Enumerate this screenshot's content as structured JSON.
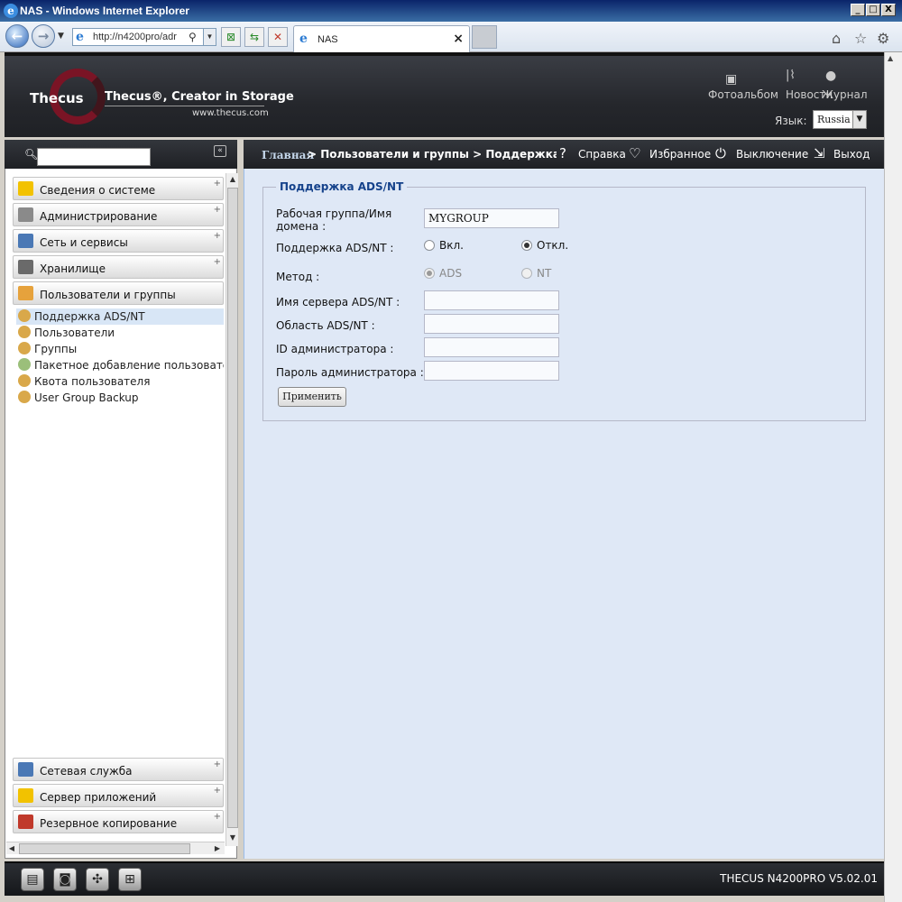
{
  "window": {
    "title": "NAS - Windows Internet Explorer",
    "minimize": "_",
    "maximize": "□",
    "close": "X"
  },
  "browser": {
    "address": "http://n4200pro/adr",
    "tab_title": "NAS",
    "tab_close": "×"
  },
  "header": {
    "brand": "Thecus",
    "tagline": "Thecus®, Creator in Storage",
    "website": "www.thecus.com",
    "links": [
      "Фотоальбом",
      "Новости",
      "Журнал"
    ],
    "language_label": "Язык:",
    "language_value": "Russia"
  },
  "sidebar": {
    "collapse_label": "«",
    "categories_top": [
      {
        "label": "Сведения о системе",
        "icon": "info-icon",
        "color": "#f2c200"
      },
      {
        "label": "Администрирование",
        "icon": "tools-icon",
        "color": "#8a8a8a"
      },
      {
        "label": "Сеть и сервисы",
        "icon": "network-icon",
        "color": "#4a78b5"
      },
      {
        "label": "Хранилище",
        "icon": "storage-icon",
        "color": "#6a6a6a"
      },
      {
        "label": "Пользователи и группы",
        "icon": "users-icon",
        "color": "#e6a23c"
      }
    ],
    "sub_items": [
      {
        "label": "Поддержка ADS/NT",
        "selected": true
      },
      {
        "label": "Пользователи",
        "selected": false
      },
      {
        "label": "Группы",
        "selected": false
      },
      {
        "label": "Пакетное добавление пользователей",
        "selected": false
      },
      {
        "label": "Квота пользователя",
        "selected": false
      },
      {
        "label": "User Group Backup",
        "selected": false
      }
    ],
    "categories_bottom": [
      {
        "label": "Сетевая служба",
        "icon": "network-service-icon",
        "color": "#4a78b5"
      },
      {
        "label": "Сервер приложений",
        "icon": "app-server-icon",
        "color": "#f2c200"
      },
      {
        "label": "Резервное копирование",
        "icon": "backup-icon",
        "color": "#c0392b"
      }
    ]
  },
  "breadcrumb": {
    "home": "Главная",
    "path": "> Пользователи и группы > Поддержка ADS/NT"
  },
  "toolbar": {
    "help": "Справка",
    "favorites": "Избранное",
    "shutdown": "Выключение",
    "logout": "Выход"
  },
  "form": {
    "legend": "Поддержка ADS/NT",
    "workgroup_label": "Рабочая группа/Имя домена :",
    "workgroup_value": "MYGROUP",
    "ads_support_label": "Поддержка ADS/NT :",
    "ads_support_on": "Вкл.",
    "ads_support_off": "Откл.",
    "ads_support_selected": "off",
    "method_label": "Метод :",
    "method_ads": "ADS",
    "method_nt": "NT",
    "method_selected": "ADS",
    "server_label": "Имя сервера ADS/NT :",
    "server_value": "",
    "realm_label": "Область ADS/NT :",
    "realm_value": "",
    "admin_id_label": "ID администратора :",
    "admin_id_value": "",
    "admin_password_label": "Пароль администратора :",
    "admin_password_value": "",
    "apply_label": "Применить"
  },
  "footer": {
    "model": "THECUS N4200PRO V5.02.01",
    "icons": [
      "server-icon",
      "disk-icon",
      "fan-icon",
      "network-tree-icon"
    ]
  }
}
